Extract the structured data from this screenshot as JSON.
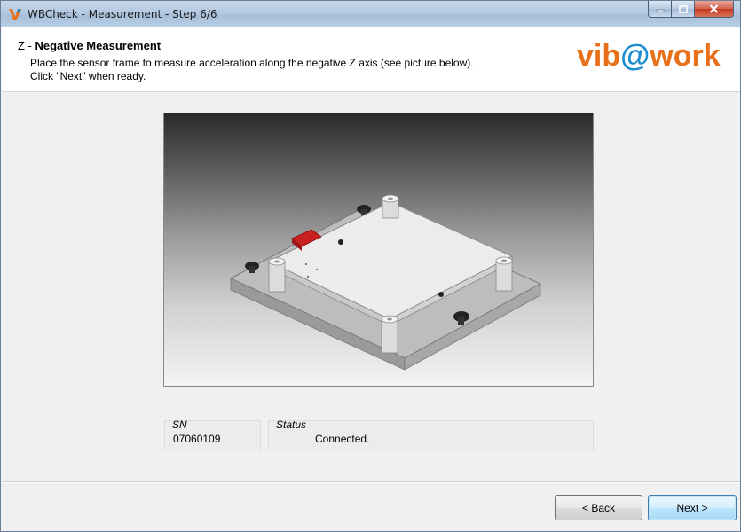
{
  "window": {
    "title": "WBCheck - Measurement - Step 6/6"
  },
  "header": {
    "step_prefix": "Z - ",
    "step_title": "Negative Measurement",
    "instruction_line1": "Place the sensor frame to measure acceleration along the negative Z axis (see picture below).",
    "instruction_line2": "Click \"Next\" when ready.",
    "logo_part1": "vib",
    "logo_at": "@",
    "logo_part2": "work"
  },
  "sensor": {
    "sn_label": "SN",
    "sn_value": "07060109",
    "status_label": "Status",
    "status_value": "Connected."
  },
  "footer": {
    "back_label": "< Back",
    "next_label": "Next >"
  },
  "colors": {
    "logo_orange": "#e8701a",
    "logo_blue": "#1d8fd0",
    "sensor_red": "#c8211f"
  }
}
